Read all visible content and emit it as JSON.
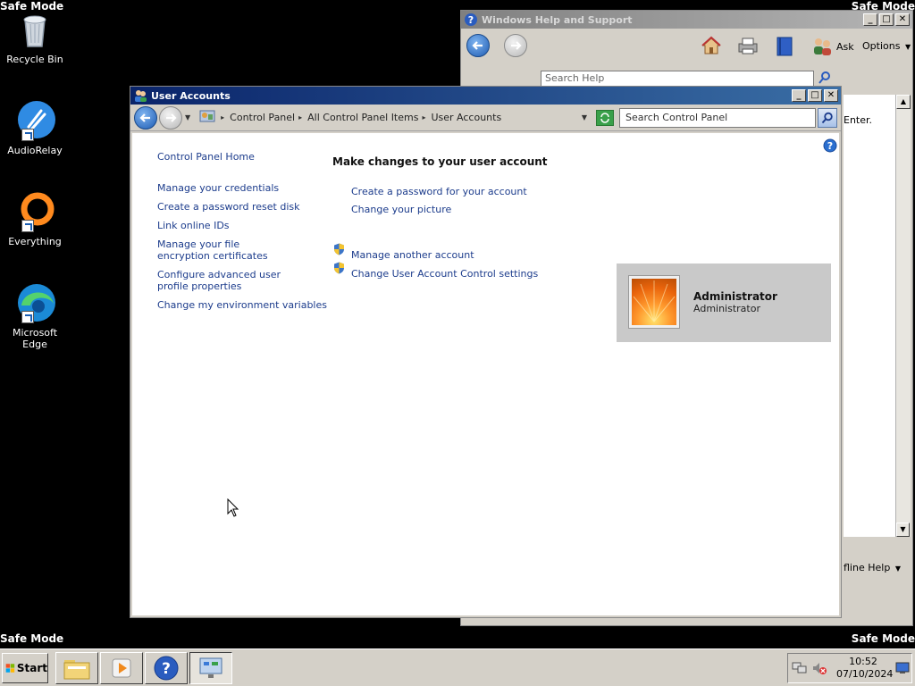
{
  "desktop": {
    "safe_mode_label": "Safe Mode",
    "icons": [
      {
        "label": "Recycle Bin",
        "icon": "recycle-bin-icon"
      },
      {
        "label": "AudioRelay",
        "icon": "audiorelay-icon"
      },
      {
        "label": "Everything",
        "icon": "everything-icon"
      },
      {
        "label": "Microsoft Edge",
        "icon": "edge-icon"
      }
    ]
  },
  "help_window": {
    "title": "Windows Help and Support",
    "search_placeholder": "Search Help",
    "ask_label": "Ask",
    "options_label": "Options",
    "partial_text": "Enter.",
    "footer_partial": "fline Help"
  },
  "ua_window": {
    "title": "User Accounts",
    "breadcrumbs": [
      "Control Panel",
      "All Control Panel Items",
      "User Accounts"
    ],
    "search_placeholder": "Search Control Panel",
    "sidebar_links": [
      "Control Panel Home",
      "Manage your credentials",
      "Create a password reset disk",
      "Link online IDs",
      "Manage your file encryption certificates",
      "Configure advanced user profile properties",
      "Change my environment variables"
    ],
    "heading": "Make changes to your user account",
    "main_links": [
      "Create a password for your account",
      "Change your picture"
    ],
    "shield_links": [
      "Manage another account",
      "Change User Account Control settings"
    ],
    "account": {
      "name": "Administrator",
      "type": "Administrator"
    }
  },
  "taskbar": {
    "start_label": "Start",
    "clock_time": "10:52",
    "clock_date": "07/10/2024"
  },
  "colors": {
    "link": "#1c3c8c",
    "title_active": "#0a246a",
    "desktop": "#000000"
  }
}
